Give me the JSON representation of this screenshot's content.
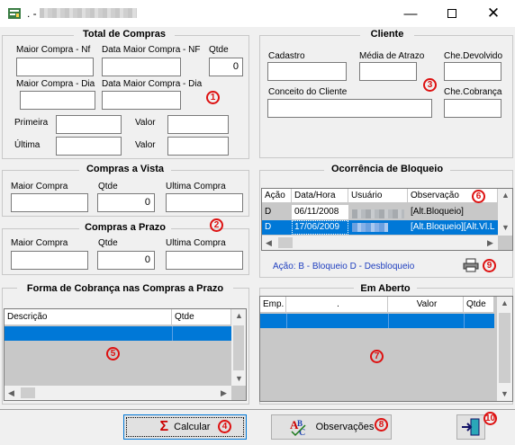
{
  "window": {
    "title": ". -",
    "colors": {
      "selection": "#0078d7",
      "marker": "#dd1111",
      "grid_bg": "#c8c8c8"
    }
  },
  "total_compras": {
    "title": "Total de Compras",
    "maior_compra_nf_label": "Maior Compra - Nf",
    "data_maior_compra_nf_label": "Data Maior Compra - NF",
    "qtde_label": "Qtde",
    "qtde_value": "0",
    "maior_compra_dia_label": "Maior Compra - Dia",
    "data_maior_compra_dia_label": "Data Maior Compra - Dia",
    "primeira_label": "Primeira",
    "ultima_label": "Última",
    "valor_label": "Valor",
    "valor2_label": "Valor"
  },
  "cliente": {
    "title": "Cliente",
    "cadastro_label": "Cadastro",
    "media_atrazo_label": "Média de Atrazo",
    "che_devolvido_label": "Che.Devolvido",
    "conceito_label": "Conceito do Cliente",
    "che_cobranca_label": "Che.Cobrança"
  },
  "compras_vista": {
    "title": "Compras a Vista",
    "maior_compra_label": "Maior Compra",
    "qtde_label": "Qtde",
    "qtde_value": "0",
    "ultima_compra_label": "Ultima Compra"
  },
  "compras_prazo": {
    "title": "Compras a Prazo",
    "maior_compra_label": "Maior Compra",
    "qtde_label": "Qtde",
    "qtde_value": "0",
    "ultima_compra_label": "Ultima Compra"
  },
  "ocorrencia": {
    "title": "Ocorrência de Bloqueio",
    "columns": [
      "Ação",
      "Data/Hora",
      "Usuário",
      "Observação"
    ],
    "rows": [
      {
        "acao": "D",
        "data": "06/11/2008",
        "obs": "[Alt.Bloqueio]"
      },
      {
        "acao": "D",
        "data": "17/06/2009",
        "obs": "[Alt.Bloqueio][Alt.Vl.L"
      }
    ],
    "legend": "Ação: B - Bloqueio    D - Desbloqueio"
  },
  "forma_cobranca": {
    "title": "Forma de Cobrança nas Compras a Prazo",
    "columns": [
      "Descrição",
      "Qtde"
    ]
  },
  "em_aberto": {
    "title": "Em Aberto",
    "columns": [
      "Emp.",
      ".",
      "Valor",
      "Qtde"
    ]
  },
  "buttons": {
    "calcular": "Calcular",
    "observacoes": "Observações"
  },
  "markers": [
    "1",
    "2",
    "3",
    "4",
    "5",
    "6",
    "7",
    "8",
    "9",
    "10"
  ]
}
